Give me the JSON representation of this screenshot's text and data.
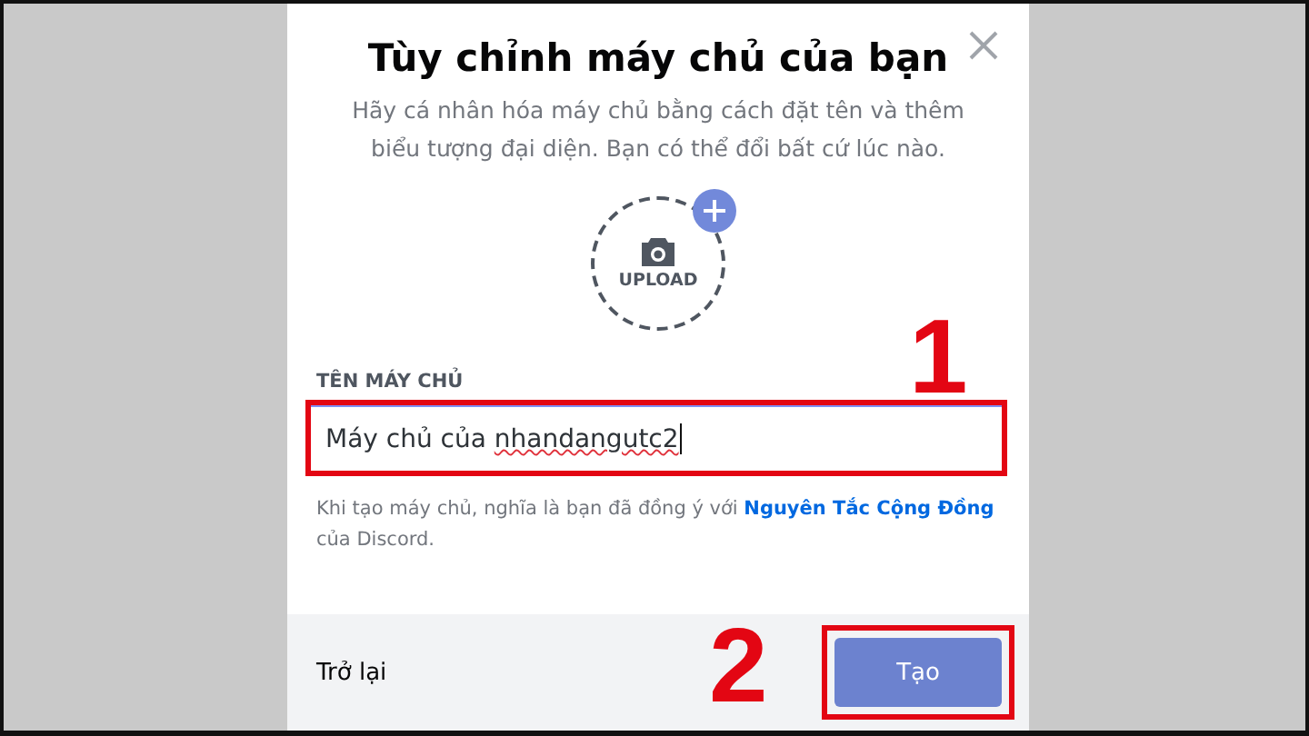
{
  "dialog": {
    "title": "Tùy chỉnh máy chủ của bạn",
    "description": "Hãy cá nhân hóa máy chủ bằng cách đặt tên và thêm biểu tượng đại diện. Bạn có thể đổi bất cứ lúc nào.",
    "upload_label": "UPLOAD",
    "field_label": "TÊN MÁY CHỦ",
    "field_value_prefix": "Máy chủ của ",
    "field_value_misspelled": "nhandangutc2",
    "field_highlighted": true,
    "note_before": "Khi tạo máy chủ, nghĩa là bạn đã đồng ý với ",
    "note_link": "Nguyên Tắc Cộng Đồng",
    "note_after": " của Discord.",
    "back_label": "Trở lại",
    "create_label": "Tạo",
    "create_highlighted": true
  },
  "annotations": [
    {
      "label": "1"
    },
    {
      "label": "2"
    }
  ]
}
